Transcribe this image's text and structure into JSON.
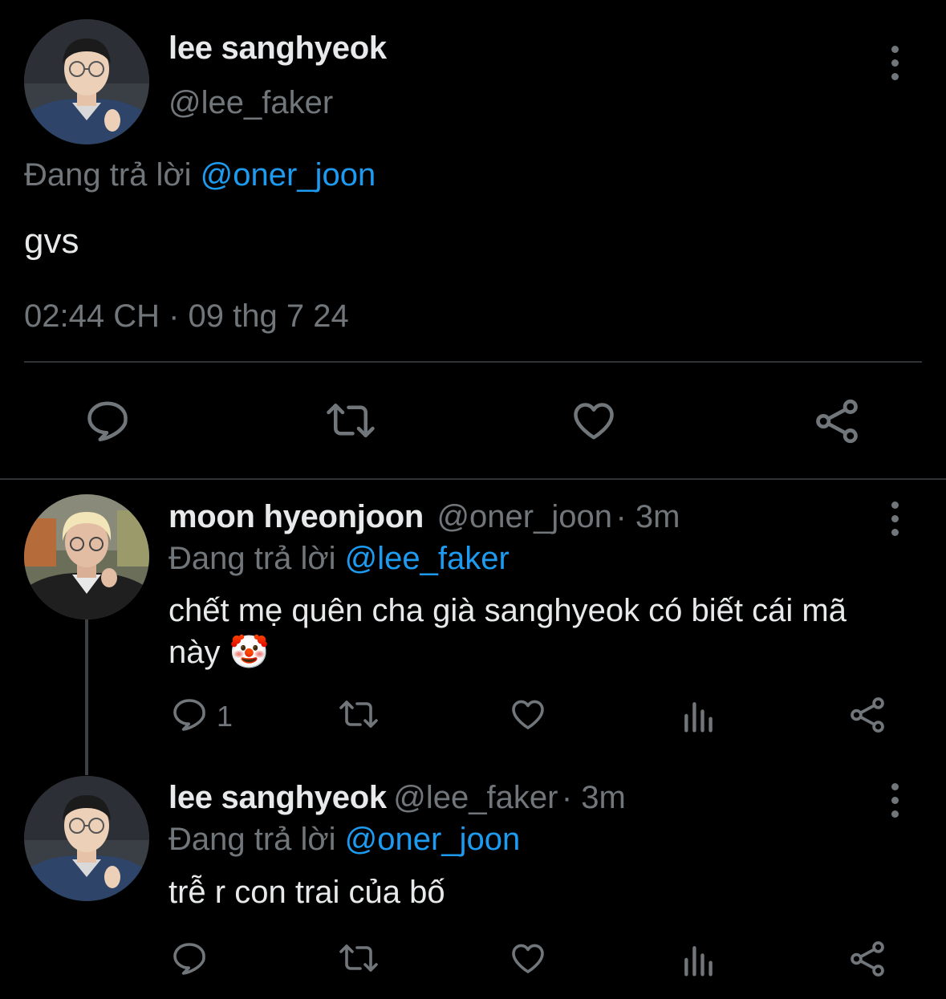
{
  "main_tweet": {
    "author_name": "lee sanghyeok",
    "author_handle": "@lee_faker",
    "replying_prefix": "Đang trả lời",
    "replying_to": "@oner_joon",
    "text": "gvs",
    "timestamp": "02:44 CH · 09 thg 7 24",
    "actions": [
      "reply-icon",
      "retweet-icon",
      "like-icon",
      "share-icon"
    ]
  },
  "replies": [
    {
      "author_name": "moon hyeonjoon",
      "author_handle": "@oner_joon",
      "time": "· 3m",
      "replying_prefix": "Đang trả lời",
      "replying_to": "@lee_faker",
      "text": "chết mẹ quên cha già sanghyeok có biết cái mã này",
      "emoji": "🤡",
      "reply_count": "1"
    },
    {
      "author_name": "lee sanghyeok",
      "author_handle": "@lee_faker",
      "time": "· 3m",
      "replying_prefix": "Đang trả lời",
      "replying_to": "@oner_joon",
      "text": "trễ r con trai của bố",
      "reply_count": ""
    }
  ],
  "colors": {
    "background": "#000000",
    "text": "#e7e9ea",
    "muted": "#71767b",
    "link": "#1d9bf0",
    "divider": "#2f3336"
  }
}
